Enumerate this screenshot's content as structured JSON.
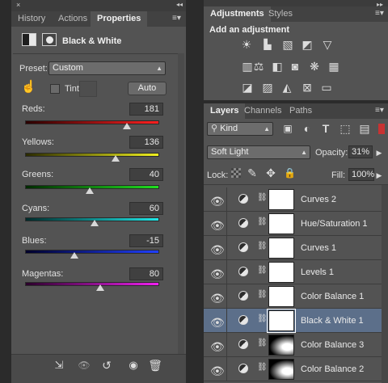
{
  "left_panel": {
    "collapse_glyph": "◂◂",
    "close_glyph": "×",
    "tabs": [
      {
        "label": "History"
      },
      {
        "label": "Actions"
      },
      {
        "label": "Properties"
      }
    ],
    "title": "Black & White",
    "preset_label": "Preset:",
    "preset_value": "Custom",
    "tint_label": "Tint",
    "auto_label": "Auto",
    "sliders": [
      {
        "label": "Reds:",
        "value": "181"
      },
      {
        "label": "Yellows:",
        "value": "136"
      },
      {
        "label": "Greens:",
        "value": "40"
      },
      {
        "label": "Cyans:",
        "value": "60"
      },
      {
        "label": "Blues:",
        "value": "-15"
      },
      {
        "label": "Magentas:",
        "value": "80"
      }
    ]
  },
  "right_panel": {
    "collapse_glyph": "▸▸",
    "tabs_top": [
      {
        "label": "Adjustments"
      },
      {
        "label": "Styles"
      }
    ],
    "add_adjustment_label": "Add an adjustment",
    "tabs_layers": [
      {
        "label": "Layers"
      },
      {
        "label": "Channels"
      },
      {
        "label": "Paths"
      }
    ],
    "kind_value": "Kind",
    "blend_mode": "Soft Light",
    "opacity_label": "Opacity:",
    "opacity_value": "31%",
    "lock_label": "Lock:",
    "fill_label": "Fill:",
    "fill_value": "100%",
    "layers": [
      {
        "name": "Curves 2",
        "selected": false
      },
      {
        "name": "Hue/Saturation 1",
        "selected": false
      },
      {
        "name": "Curves 1",
        "selected": false
      },
      {
        "name": "Levels 1",
        "selected": false
      },
      {
        "name": "Color Balance 1",
        "selected": false
      },
      {
        "name": "Black & White 1",
        "selected": true
      },
      {
        "name": "Color Balance 3",
        "selected": false
      },
      {
        "name": "Color Balance 2",
        "selected": false
      }
    ]
  }
}
